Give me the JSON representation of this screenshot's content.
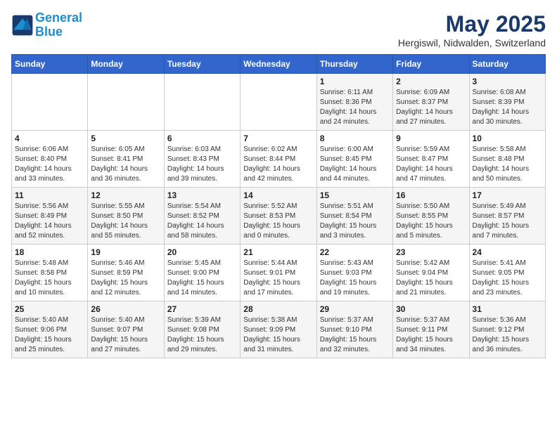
{
  "header": {
    "logo_line1": "General",
    "logo_line2": "Blue",
    "month_title": "May 2025",
    "subtitle": "Hergiswil, Nidwalden, Switzerland"
  },
  "weekdays": [
    "Sunday",
    "Monday",
    "Tuesday",
    "Wednesday",
    "Thursday",
    "Friday",
    "Saturday"
  ],
  "weeks": [
    [
      {
        "day": "",
        "info": ""
      },
      {
        "day": "",
        "info": ""
      },
      {
        "day": "",
        "info": ""
      },
      {
        "day": "",
        "info": ""
      },
      {
        "day": "1",
        "info": "Sunrise: 6:11 AM\nSunset: 8:36 PM\nDaylight: 14 hours\nand 24 minutes."
      },
      {
        "day": "2",
        "info": "Sunrise: 6:09 AM\nSunset: 8:37 PM\nDaylight: 14 hours\nand 27 minutes."
      },
      {
        "day": "3",
        "info": "Sunrise: 6:08 AM\nSunset: 8:39 PM\nDaylight: 14 hours\nand 30 minutes."
      }
    ],
    [
      {
        "day": "4",
        "info": "Sunrise: 6:06 AM\nSunset: 8:40 PM\nDaylight: 14 hours\nand 33 minutes."
      },
      {
        "day": "5",
        "info": "Sunrise: 6:05 AM\nSunset: 8:41 PM\nDaylight: 14 hours\nand 36 minutes."
      },
      {
        "day": "6",
        "info": "Sunrise: 6:03 AM\nSunset: 8:43 PM\nDaylight: 14 hours\nand 39 minutes."
      },
      {
        "day": "7",
        "info": "Sunrise: 6:02 AM\nSunset: 8:44 PM\nDaylight: 14 hours\nand 42 minutes."
      },
      {
        "day": "8",
        "info": "Sunrise: 6:00 AM\nSunset: 8:45 PM\nDaylight: 14 hours\nand 44 minutes."
      },
      {
        "day": "9",
        "info": "Sunrise: 5:59 AM\nSunset: 8:47 PM\nDaylight: 14 hours\nand 47 minutes."
      },
      {
        "day": "10",
        "info": "Sunrise: 5:58 AM\nSunset: 8:48 PM\nDaylight: 14 hours\nand 50 minutes."
      }
    ],
    [
      {
        "day": "11",
        "info": "Sunrise: 5:56 AM\nSunset: 8:49 PM\nDaylight: 14 hours\nand 52 minutes."
      },
      {
        "day": "12",
        "info": "Sunrise: 5:55 AM\nSunset: 8:50 PM\nDaylight: 14 hours\nand 55 minutes."
      },
      {
        "day": "13",
        "info": "Sunrise: 5:54 AM\nSunset: 8:52 PM\nDaylight: 14 hours\nand 58 minutes."
      },
      {
        "day": "14",
        "info": "Sunrise: 5:52 AM\nSunset: 8:53 PM\nDaylight: 15 hours\nand 0 minutes."
      },
      {
        "day": "15",
        "info": "Sunrise: 5:51 AM\nSunset: 8:54 PM\nDaylight: 15 hours\nand 3 minutes."
      },
      {
        "day": "16",
        "info": "Sunrise: 5:50 AM\nSunset: 8:55 PM\nDaylight: 15 hours\nand 5 minutes."
      },
      {
        "day": "17",
        "info": "Sunrise: 5:49 AM\nSunset: 8:57 PM\nDaylight: 15 hours\nand 7 minutes."
      }
    ],
    [
      {
        "day": "18",
        "info": "Sunrise: 5:48 AM\nSunset: 8:58 PM\nDaylight: 15 hours\nand 10 minutes."
      },
      {
        "day": "19",
        "info": "Sunrise: 5:46 AM\nSunset: 8:59 PM\nDaylight: 15 hours\nand 12 minutes."
      },
      {
        "day": "20",
        "info": "Sunrise: 5:45 AM\nSunset: 9:00 PM\nDaylight: 15 hours\nand 14 minutes."
      },
      {
        "day": "21",
        "info": "Sunrise: 5:44 AM\nSunset: 9:01 PM\nDaylight: 15 hours\nand 17 minutes."
      },
      {
        "day": "22",
        "info": "Sunrise: 5:43 AM\nSunset: 9:03 PM\nDaylight: 15 hours\nand 19 minutes."
      },
      {
        "day": "23",
        "info": "Sunrise: 5:42 AM\nSunset: 9:04 PM\nDaylight: 15 hours\nand 21 minutes."
      },
      {
        "day": "24",
        "info": "Sunrise: 5:41 AM\nSunset: 9:05 PM\nDaylight: 15 hours\nand 23 minutes."
      }
    ],
    [
      {
        "day": "25",
        "info": "Sunrise: 5:40 AM\nSunset: 9:06 PM\nDaylight: 15 hours\nand 25 minutes."
      },
      {
        "day": "26",
        "info": "Sunrise: 5:40 AM\nSunset: 9:07 PM\nDaylight: 15 hours\nand 27 minutes."
      },
      {
        "day": "27",
        "info": "Sunrise: 5:39 AM\nSunset: 9:08 PM\nDaylight: 15 hours\nand 29 minutes."
      },
      {
        "day": "28",
        "info": "Sunrise: 5:38 AM\nSunset: 9:09 PM\nDaylight: 15 hours\nand 31 minutes."
      },
      {
        "day": "29",
        "info": "Sunrise: 5:37 AM\nSunset: 9:10 PM\nDaylight: 15 hours\nand 32 minutes."
      },
      {
        "day": "30",
        "info": "Sunrise: 5:37 AM\nSunset: 9:11 PM\nDaylight: 15 hours\nand 34 minutes."
      },
      {
        "day": "31",
        "info": "Sunrise: 5:36 AM\nSunset: 9:12 PM\nDaylight: 15 hours\nand 36 minutes."
      }
    ]
  ]
}
